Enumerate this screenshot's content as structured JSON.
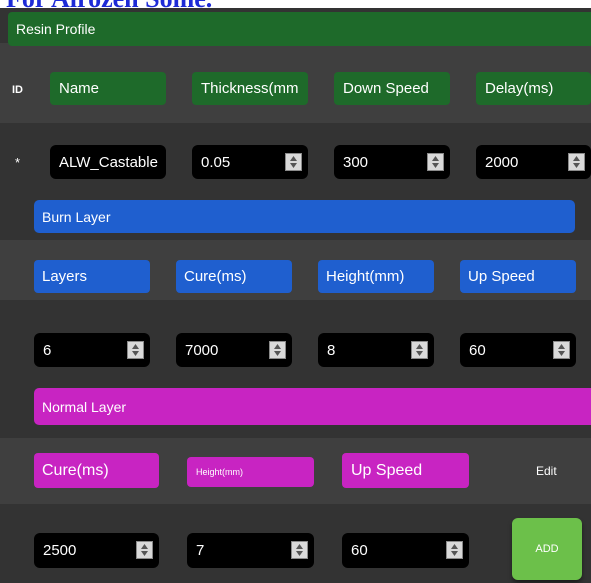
{
  "page": {
    "top_title": "For Airozen Some."
  },
  "resin_profile": {
    "title": "Resin Profile",
    "id_label": "ID",
    "headers": [
      "Name",
      "Thickness(mm",
      "Down Speed",
      "Delay(ms)"
    ],
    "row_marker": "*",
    "values": [
      "ALW_Castable",
      "0.05",
      "300",
      "2000"
    ]
  },
  "burn_layer": {
    "title": "Burn Layer",
    "headers": [
      "Layers",
      "Cure(ms)",
      "Height(mm)",
      "Up Speed"
    ],
    "values": [
      "6",
      "7000",
      "8",
      "60"
    ]
  },
  "normal_layer": {
    "title": "Normal Layer",
    "headers": [
      "Cure(ms)",
      "Height(mm)",
      "Up Speed"
    ],
    "edit_label": "Edit",
    "values": [
      "2500",
      "7",
      "60"
    ],
    "add_label": "ADD"
  },
  "colors": {
    "green": "#1e6a2a",
    "blue": "#1f5fcf",
    "magenta": "#c824c2",
    "add": "#6cc04a",
    "panel": "#333333"
  }
}
